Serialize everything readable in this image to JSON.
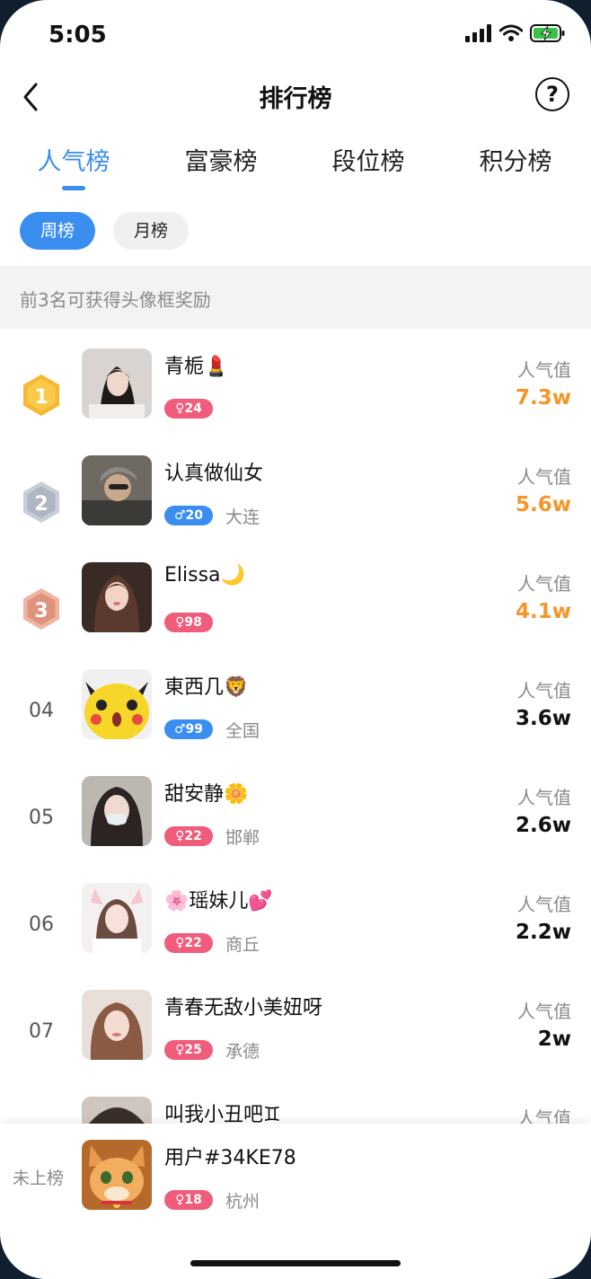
{
  "status": {
    "time": "5:05"
  },
  "nav": {
    "title": "排行榜",
    "help": "?"
  },
  "tabs": [
    "人气榜",
    "富豪榜",
    "段位榜",
    "积分榜"
  ],
  "periods": [
    "周榜",
    "月榜"
  ],
  "banner": "前3名可获得头像框奖励",
  "entries": [
    {
      "rank_icon": "1",
      "name": "青栀💄",
      "badge": "♀24",
      "city": "",
      "label": "人气值",
      "value": "7.3w"
    },
    {
      "rank_icon": "2",
      "name": "认真做仙女",
      "badge": "♂20",
      "city": "大连",
      "label": "人气值",
      "value": "5.6w"
    },
    {
      "rank_icon": "3",
      "name": "Elissa🌙",
      "badge": "♀98",
      "city": "",
      "label": "人气值",
      "value": "4.1w"
    },
    {
      "rank": "04",
      "name": "東西几🦁",
      "badge": "♂99",
      "city": "全国",
      "label": "人气值",
      "value": "3.6w"
    },
    {
      "rank": "05",
      "name": "甜安静🌼",
      "badge": "♀22",
      "city": "邯郸",
      "label": "人气值",
      "value": "2.6w"
    },
    {
      "rank": "06",
      "name": "🌸瑶妹儿💕",
      "badge": "♀22",
      "city": "商丘",
      "label": "人气值",
      "value": "2.2w"
    },
    {
      "rank": "07",
      "name": "青春无敌小美妞呀",
      "badge": "♀25",
      "city": "承德",
      "label": "人气值",
      "value": "2w"
    },
    {
      "name": "叫我小丑吧♊",
      "label": "人气值"
    }
  ],
  "me": {
    "status": "未上榜",
    "name": "用户#34KE78",
    "badge": "♀18",
    "city": "杭州"
  },
  "colors": {
    "accent": "#3a8ef0",
    "female": "#f05c7b",
    "male": "#3a8ef0",
    "top3_value": "#f5962a",
    "gold": "#f7b731",
    "silver": "#aeb6c4",
    "bronze": "#e0937c"
  }
}
